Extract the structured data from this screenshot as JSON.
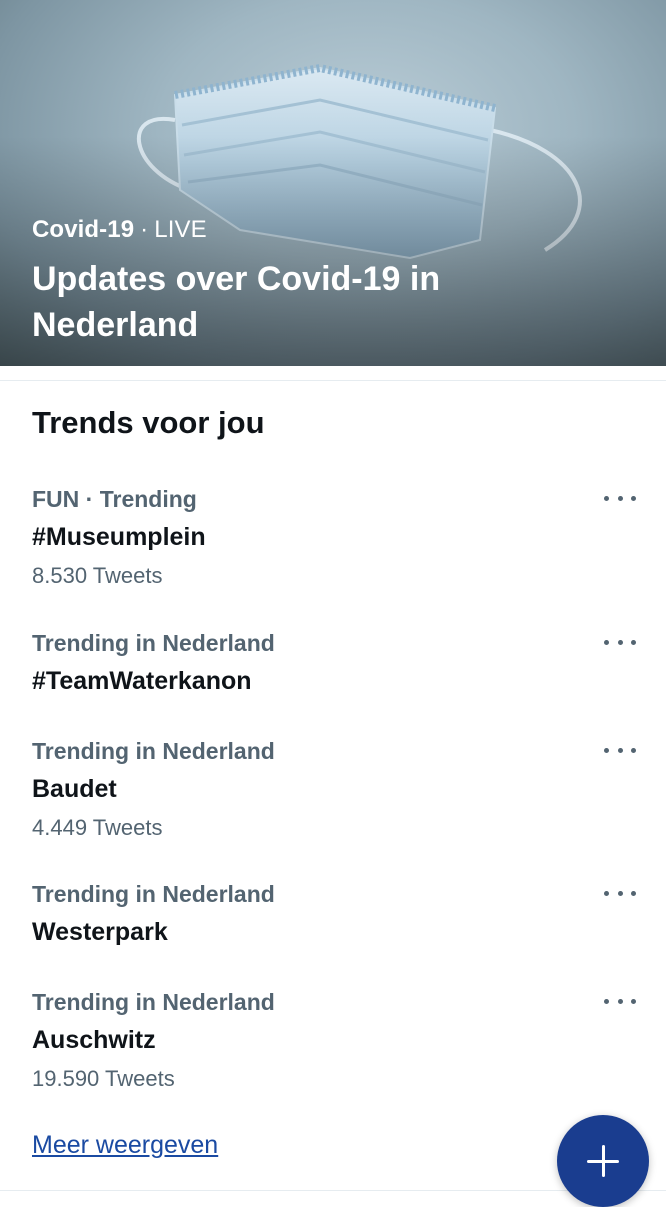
{
  "hero": {
    "category": "Covid-19",
    "separator": "·",
    "status": "LIVE",
    "title": "Updates over Covid-19 in Nederland",
    "image": "face-mask-photo"
  },
  "trends": {
    "heading": "Trends voor jou",
    "items": [
      {
        "context": "FUN · Trending",
        "name": "#Museumplein",
        "count": "8.530 Tweets"
      },
      {
        "context": "Trending in Nederland",
        "name": "#TeamWaterkanon",
        "count": ""
      },
      {
        "context": "Trending in Nederland",
        "name": "Baudet",
        "count": "4.449 Tweets"
      },
      {
        "context": "Trending in Nederland",
        "name": "Westerpark",
        "count": ""
      },
      {
        "context": "Trending in Nederland",
        "name": "Auschwitz",
        "count": "19.590 Tweets"
      }
    ],
    "more_icon": "more-horizontal-icon",
    "show_more": "Meer weergeven"
  },
  "fab": {
    "icon": "plus-icon"
  },
  "colors": {
    "text_primary": "#0f1419",
    "text_secondary": "#536471",
    "link": "#1a4aa2",
    "fab": "#1a3d8f"
  }
}
